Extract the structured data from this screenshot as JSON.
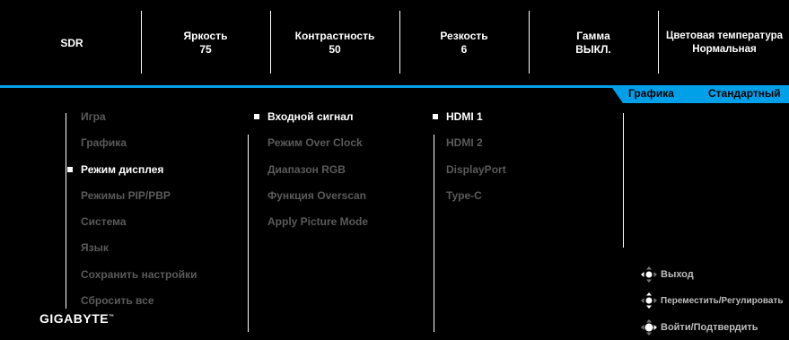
{
  "status": {
    "mode": "SDR",
    "brightness": {
      "label": "Яркость",
      "value": "75"
    },
    "contrast": {
      "label": "Контрастность",
      "value": "50"
    },
    "sharpness": {
      "label": "Резкость",
      "value": "6"
    },
    "gamma": {
      "label": "Гамма",
      "value": "ВЫКЛ."
    },
    "color_temp": {
      "label": "Цветовая температура",
      "value": "Нормальная"
    }
  },
  "accent": {
    "section": "Графика",
    "preset": "Стандартный",
    "color": "#00a0e9"
  },
  "menu": {
    "items": [
      "Игра",
      "Графика",
      "Режим дисплея",
      "Режимы PIP/PBP",
      "Система",
      "Язык",
      "Сохранить настройки",
      "Сбросить все"
    ]
  },
  "submenu": {
    "items": [
      "Входной сигнал",
      "Режим Over Clock",
      "Диапазон RGB",
      "Функция Overscan",
      "Apply Picture Mode"
    ]
  },
  "inputs": {
    "items": [
      "HDMI 1",
      "HDMI 2",
      "DisplayPort",
      "Type-C"
    ]
  },
  "brand": "GIGABYTE",
  "hints": {
    "exit": "Выход",
    "move": "Переместить/Регулировать",
    "enter": "Войти/Подтвердить"
  }
}
